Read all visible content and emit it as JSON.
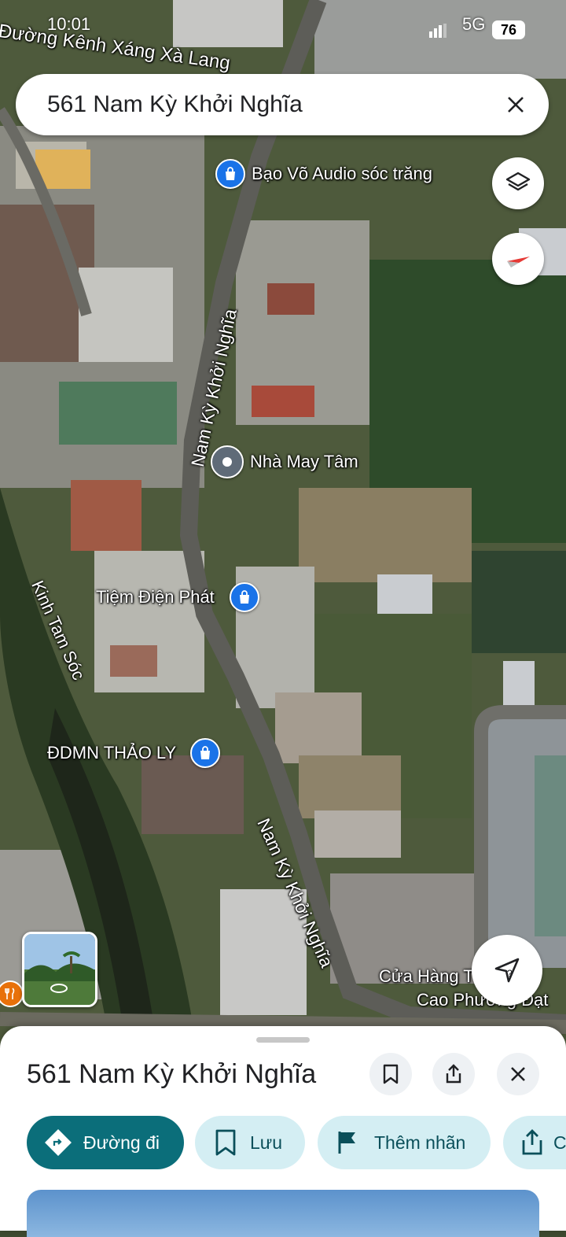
{
  "status_bar": {
    "time": "10:01",
    "network": "5G",
    "battery": "76"
  },
  "search": {
    "query": "561 Nam Kỳ Khởi Nghĩa"
  },
  "map": {
    "road_labels": [
      "Đường Kênh Xáng Xà Lang",
      "Nam Kỳ Khởi Nghĩa",
      "Kinh Tam Sóc",
      "Nam Kỳ Khởi Nghĩa"
    ],
    "pois": [
      {
        "name": "Bạo Võ Audio sóc trăng",
        "icon": "shopping-bag-icon"
      },
      {
        "name": "Nhà May Tâm",
        "icon": "location-pin-icon"
      },
      {
        "name": "Tiệm Điện Phát",
        "icon": "shopping-bag-icon"
      },
      {
        "name": "ĐDMN THẢO LY",
        "icon": "shopping-bag-icon"
      },
      {
        "name": "Cửa Hàng T",
        "icon": "shopping-bag-icon"
      },
      {
        "name": "Cao Phương Đạt",
        "icon": "shopping-bag-icon"
      }
    ]
  },
  "sheet": {
    "title": "561 Nam Kỳ Khởi Nghĩa",
    "chips": [
      {
        "label": "Đường đi",
        "icon": "directions-icon"
      },
      {
        "label": "Lưu",
        "icon": "bookmark-icon"
      },
      {
        "label": "Thêm nhãn",
        "icon": "flag-icon"
      },
      {
        "label": "C",
        "icon": "share-icon"
      }
    ]
  },
  "colors": {
    "primary": "#0b6e7a",
    "chip_bg": "#d4eef3",
    "pin_blue": "#1a73e8"
  }
}
